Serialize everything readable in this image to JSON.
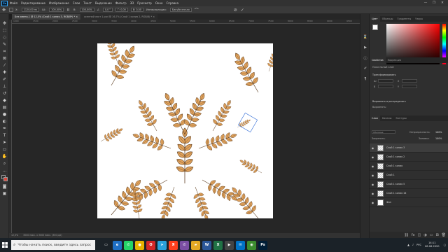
{
  "app": {
    "logo": "Ps",
    "menu": [
      "Файл",
      "Редактирование",
      "Изображение",
      "Слои",
      "Текст",
      "Выделение",
      "Фильтр",
      "3D",
      "Просмотр",
      "Окно",
      "Справка"
    ],
    "window_controls": [
      "—",
      "❐",
      "✕"
    ]
  },
  "options_bar": {
    "x_value": "1120,00 пк",
    "w_value": "100,00%",
    "h_value": "100,00%",
    "angle_value": "0,0 °",
    "h_skew": "Г: 0,00",
    "v_skew": "В: 0,00",
    "interpolation_label": "Интерполяция:",
    "interpolation_value": "Бикубическая"
  },
  "tabs": [
    {
      "label": "Без имени-1 @ 12,5% (Слой 1 копия 3, RGB/8*) *  ×",
      "active": true
    },
    {
      "label": "осенний лист 1.psd @ 16,7% (Слой 1 копия 2, RGB/8) *  ×",
      "active": false
    }
  ],
  "ruler": {
    "ticks": [
      "1000",
      "1500",
      "2000",
      "2500",
      "3000",
      "3500",
      "4000",
      "4500",
      "5000",
      "5500",
      "6000",
      "6500",
      "7000",
      "7500",
      "8000",
      "8500",
      "9000",
      "9500"
    ]
  },
  "status": {
    "zoom": "12,5%",
    "doc_info": "3000 пикс. x 3000 пикс. (300 ppi)"
  },
  "color_panel": {
    "tabs": [
      "Цвет",
      "Образцы",
      "Градиенты",
      "Узоры"
    ],
    "hue_color": "#ff0000",
    "foreground": "#ffffff",
    "background": "#d9473c"
  },
  "properties_panel": {
    "tabs": [
      "Свойства",
      "Коррекция"
    ],
    "layer_type": "Пиксельный слой",
    "transform_label": "Трансформировать",
    "w_label": "Ш",
    "h_label": "В",
    "x_label": "X",
    "y_label": "Y",
    "align_label": "Выровнять и распределить",
    "align_sub": "Выровнять:"
  },
  "layers_panel": {
    "tabs": [
      "Слои",
      "Каналы",
      "Контуры"
    ],
    "blend_mode": "Обычные",
    "opacity_label": "Непрозрачность:",
    "opacity_value": "100%",
    "lock_label": "Закрепить:",
    "fill_label": "Заливка:",
    "fill_value": "100%",
    "layers": [
      {
        "name": "Слой 1 копия 3",
        "selected": true,
        "transparent": true
      },
      {
        "name": "Слой 1 копия 2",
        "selected": false,
        "transparent": true
      },
      {
        "name": "Слой 1 копия",
        "selected": false,
        "transparent": true
      },
      {
        "name": "Слой 1",
        "selected": false,
        "transparent": true
      },
      {
        "name": "Слой 1 копия 5",
        "selected": false,
        "transparent": true
      },
      {
        "name": "Слой 1 копия 16",
        "selected": false,
        "transparent": true
      },
      {
        "name": "Фон",
        "selected": false,
        "transparent": false
      }
    ]
  },
  "taskbar": {
    "search_placeholder": "Чтобы начать поиск, введите здесь запрос",
    "apps": [
      {
        "icon": "task-view-icon",
        "glyph": "▭",
        "color": "#1b2228"
      },
      {
        "icon": "edge-icon",
        "glyph": "e",
        "color": "#1f6fc4"
      },
      {
        "icon": "whatsapp-icon",
        "glyph": "✆",
        "color": "#25d366"
      },
      {
        "icon": "chrome-icon",
        "glyph": "●",
        "color": "#e8b000"
      },
      {
        "icon": "opera-icon",
        "glyph": "O",
        "color": "#d32727"
      },
      {
        "icon": "telegram-icon",
        "glyph": "➤",
        "color": "#2aa1da"
      },
      {
        "icon": "yandex-icon",
        "glyph": "Я",
        "color": "#fc3f1d"
      },
      {
        "icon": "viber-icon",
        "glyph": "✆",
        "color": "#7b4ea3"
      },
      {
        "icon": "explorer-icon",
        "glyph": "▰",
        "color": "#e5a924"
      },
      {
        "icon": "word-icon",
        "glyph": "W",
        "color": "#2b579a"
      },
      {
        "icon": "excel-icon",
        "glyph": "X",
        "color": "#207245"
      },
      {
        "icon": "media-icon",
        "glyph": "▶",
        "color": "#444"
      },
      {
        "icon": "mail-icon",
        "glyph": "✉",
        "color": "#0072c6"
      },
      {
        "icon": "chrome2-icon",
        "glyph": "◉",
        "color": "#3c8d2f"
      },
      {
        "icon": "photoshop-icon",
        "glyph": "Ps",
        "color": "#001e36"
      }
    ],
    "language": "РУС",
    "time": "14:11",
    "date": "08.06.2020"
  }
}
